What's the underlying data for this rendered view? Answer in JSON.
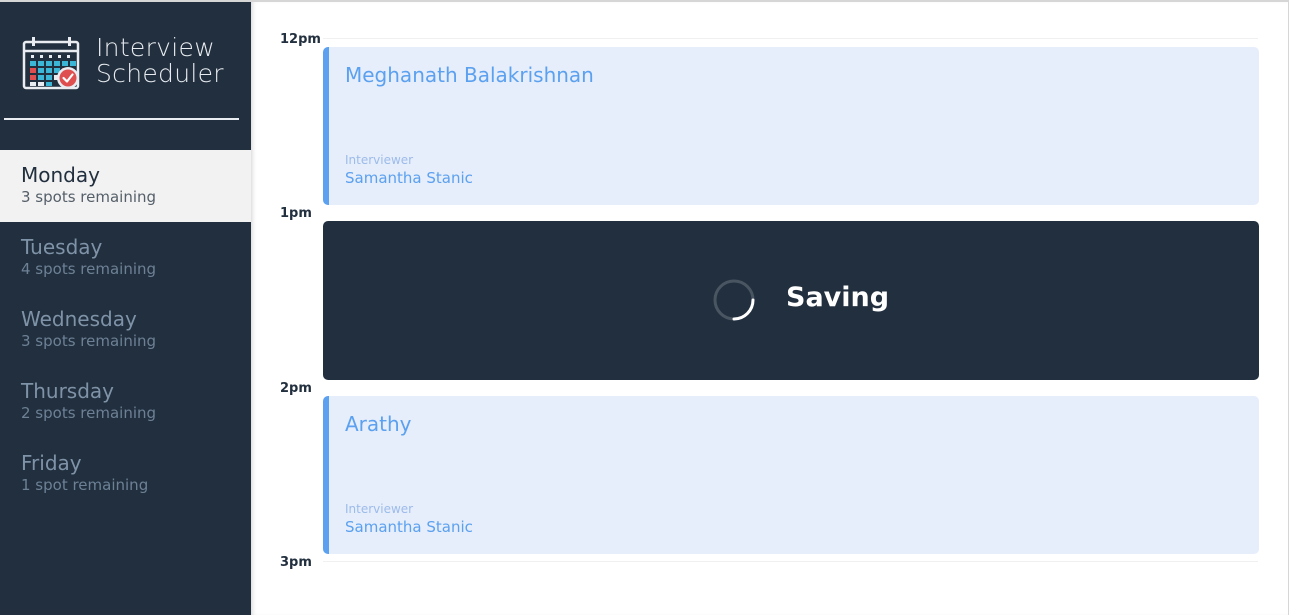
{
  "brand": {
    "title_line1": "Interview",
    "title_line2": "Scheduler",
    "logo_icon": "calendar-check-icon"
  },
  "sidebar": {
    "days": [
      {
        "name": "Monday",
        "spots": "3 spots remaining",
        "selected": true
      },
      {
        "name": "Tuesday",
        "spots": "4 spots remaining",
        "selected": false
      },
      {
        "name": "Wednesday",
        "spots": "3 spots remaining",
        "selected": false
      },
      {
        "name": "Thursday",
        "spots": "2 spots remaining",
        "selected": false
      },
      {
        "name": "Friday",
        "spots": "1 spot remaining",
        "selected": false
      }
    ]
  },
  "schedule": {
    "times": [
      "12pm",
      "1pm",
      "2pm",
      "3pm"
    ],
    "appointments": [
      {
        "student": "Meghanath Balakrishnan",
        "interviewer_caption": "Interviewer",
        "interviewer": "Samantha Stanic"
      },
      {
        "student": "Arathy",
        "interviewer_caption": "Interviewer",
        "interviewer": "Samantha Stanic"
      }
    ],
    "status": {
      "text": "Saving",
      "icon": "spinner-icon"
    }
  },
  "colors": {
    "sidebar_bg": "#222f3e",
    "appointment_bg": "#e6edfb",
    "accent_blue": "#5ba1ef",
    "status_bg": "#222f3e"
  }
}
